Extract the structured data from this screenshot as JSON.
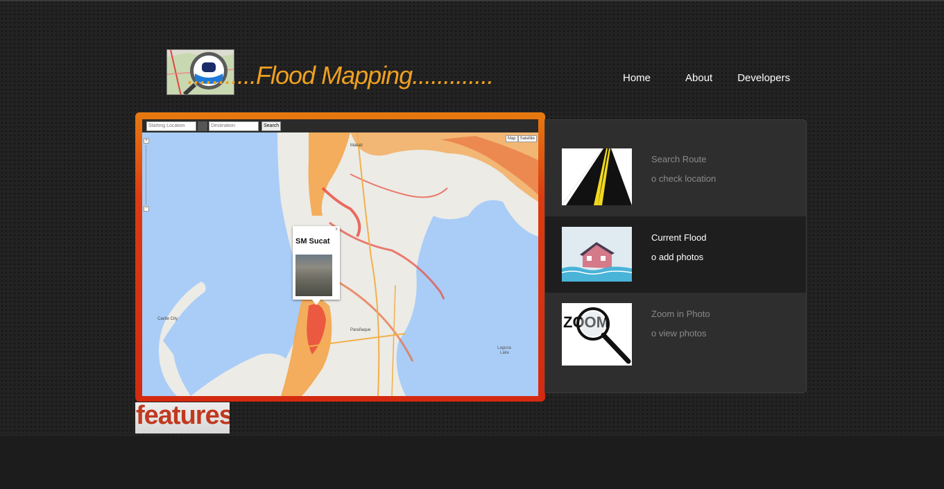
{
  "header": {
    "title": "...........Flood Mapping.............",
    "logo": "map-car-magnifier-logo"
  },
  "nav": {
    "items": [
      {
        "label": "Home"
      },
      {
        "label": "About"
      },
      {
        "label": "Developers"
      }
    ]
  },
  "map": {
    "start_placeholder": "Starting Location",
    "dest_placeholder": "Destination",
    "search_label": "Search",
    "zoom_in": "+",
    "zoom_out": "−",
    "map_type": [
      "Map",
      "Satellite"
    ],
    "popup": {
      "title": "SM Sucat",
      "close": "x"
    }
  },
  "features": [
    {
      "title": "Search Route",
      "subtitle": "o check location",
      "icon": "road-icon",
      "active": false
    },
    {
      "title": "Current Flood",
      "subtitle": "o add photos",
      "icon": "flooded-house-icon",
      "active": true
    },
    {
      "title": "Zoom in Photo",
      "subtitle": "o view photos",
      "icon": "zoom-magnifier-icon",
      "active": false
    }
  ],
  "features_badge": "features",
  "colors": {
    "accent_orange": "#f0a020",
    "frame_red": "#d42a10",
    "water": "#aacdf7",
    "land": "#ecebe6"
  }
}
